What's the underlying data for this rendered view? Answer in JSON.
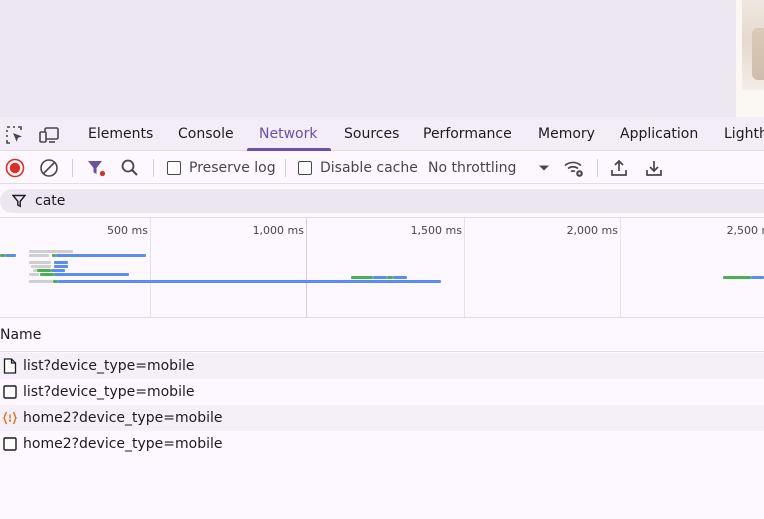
{
  "devtools": {
    "tabs": [
      {
        "label": "Elements",
        "active": false
      },
      {
        "label": "Console",
        "active": false
      },
      {
        "label": "Network",
        "active": true
      },
      {
        "label": "Sources",
        "active": false
      },
      {
        "label": "Performance",
        "active": false
      },
      {
        "label": "Memory",
        "active": false
      },
      {
        "label": "Application",
        "active": false
      },
      {
        "label": "Lighth",
        "active": false
      }
    ],
    "toolbar": {
      "preserve_log_label": "Preserve log",
      "preserve_log_checked": false,
      "disable_cache_label": "Disable cache",
      "disable_cache_checked": false,
      "throttling_value": "No throttling",
      "record_color": "#d93025",
      "accent_color": "#6b4fa8"
    },
    "filter": {
      "value": "cate"
    },
    "overview": {
      "ticks": [
        "500 ms",
        "1,000 ms",
        "1,500 ms",
        "2,000 ms",
        "2,500 ms"
      ]
    },
    "table": {
      "column_name": "Name",
      "rows": [
        {
          "name": "list?device_type=mobile",
          "icon": "document-icon"
        },
        {
          "name": "list?device_type=mobile",
          "icon": "checkbox-icon"
        },
        {
          "name": "home2?device_type=mobile",
          "icon": "fetch-xhr-icon"
        },
        {
          "name": "home2?device_type=mobile",
          "icon": "checkbox-icon"
        }
      ]
    }
  }
}
